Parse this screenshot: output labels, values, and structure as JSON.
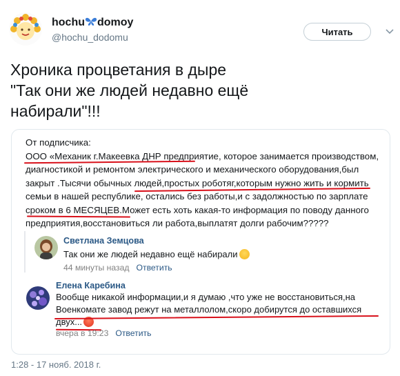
{
  "author": {
    "name_part1": "hochu",
    "name_part2": "domoy",
    "handle": "@hochu_dodomu"
  },
  "follow_button_label": "Читать",
  "tweet_text": "Хроника  процветания в дыре\n\"Так они же людей недавно ещё\nнабирали\"!!!",
  "embed": {
    "post_lines": [
      "От подписчика:",
      "ООО «Механик г.Макеевка ДНР предприятие, которое занимается производством,",
      "диагностикой и ремонтом электрического и механического оборудования,был",
      "закрыт .Тысячи обычных людей,простых роботяг,которым нужно жить и кормить",
      "семьи в нашей республике, остались без работы,и с задолжностью по зарплате",
      "сроком в 6 МЕСЯЦЕВ.Может есть хоть какая-то информация по поводу данного",
      "предприятия,восстановиться ли работа,выплатят долги рабочим?????"
    ],
    "comments": [
      {
        "name": "Светлана Земцова",
        "text": "Так они же людей недавно ещё набирали",
        "time": "44 минуты назад",
        "reply_label": "Ответить"
      },
      {
        "name": "Елена Каребина",
        "lines": [
          "Вообще никакой информации,и я думаю ,что уже не восстановиться,на",
          "Военкомате завод режут на металлолом,скоро добирутся до оставшихся",
          "двух..."
        ],
        "time": "вчера в 19:23",
        "reply_label": "Ответить"
      }
    ]
  },
  "timestamp": "1:28 - 17 нояб. 2018 г.",
  "colors": {
    "link_blue": "#2a5885",
    "underline_red": "#d8101a",
    "muted_text": "#657786"
  },
  "icons": [
    "butterfly-icon",
    "chevron-down-icon",
    "thinking-emoji-icon",
    "angry-emoji-icon"
  ]
}
